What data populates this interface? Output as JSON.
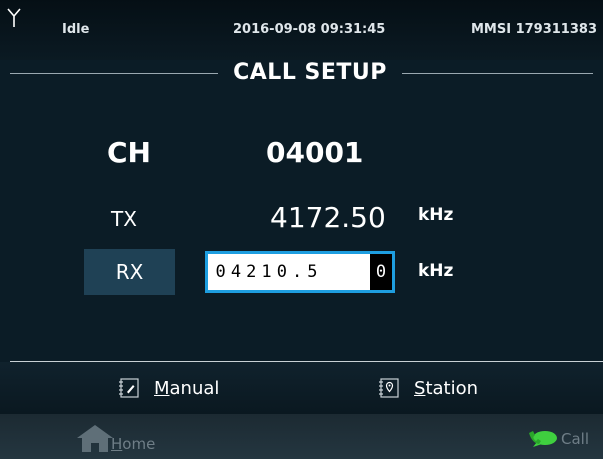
{
  "status": {
    "state": "Idle",
    "datetime": "2016-09-08 09:31:45",
    "mmsi": "MMSI 179311383",
    "antenna_icon": "antenna-icon"
  },
  "title": "CALL SETUP",
  "channel": {
    "label": "CH",
    "value": "04001"
  },
  "tx": {
    "label": "TX",
    "value": "4172.50",
    "unit": "kHz"
  },
  "rx": {
    "label": "RX",
    "chars": [
      "0",
      "4",
      "2",
      "1",
      "0",
      ".",
      "5"
    ],
    "cursor_char": "0",
    "unit": "kHz"
  },
  "options": {
    "manual": {
      "mnemonic": "M",
      "rest": "anual",
      "icon": "manual-entry-icon"
    },
    "station": {
      "mnemonic": "S",
      "rest": "tation",
      "icon": "station-list-icon"
    }
  },
  "nav": {
    "home": {
      "mnemonic": "H",
      "rest": "ome",
      "icon": "home-icon"
    },
    "call": {
      "label": "Call",
      "icon": "call-bubble-icon"
    }
  },
  "colors": {
    "background": "#0b1c26",
    "accent": "#1e9ee0",
    "rx_button": "#1f4155",
    "call_green": "#3fcf3f",
    "disabled_text": "#6f7e87"
  }
}
